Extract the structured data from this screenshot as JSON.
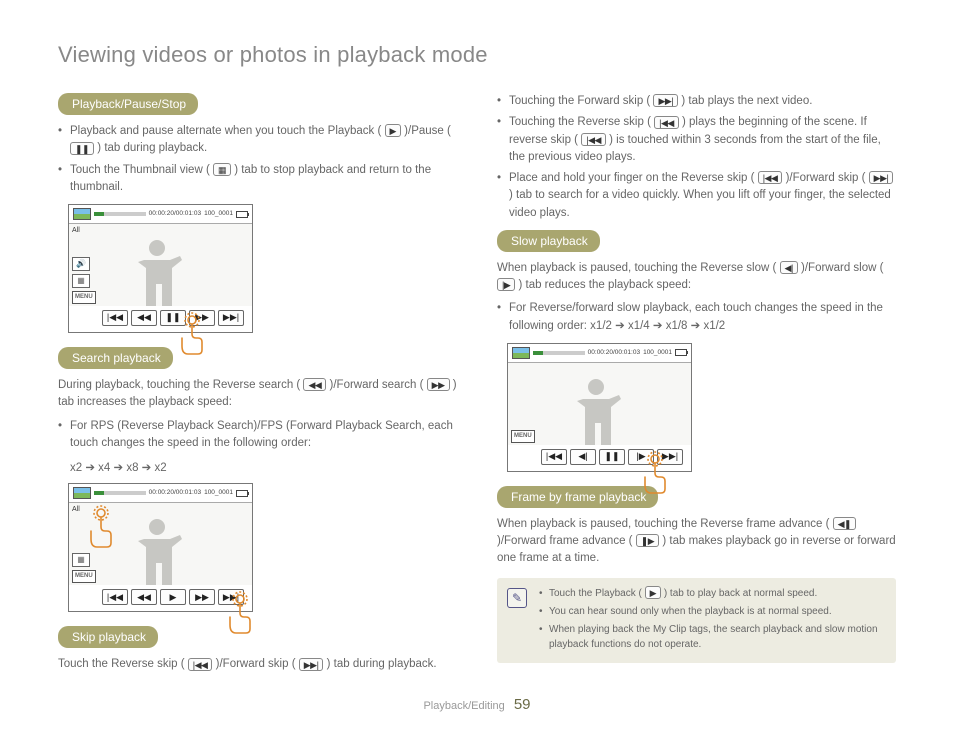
{
  "title": "Viewing videos or photos in playback mode",
  "footer": {
    "section": "Playback/Editing",
    "page": "59"
  },
  "screenshot": {
    "timecode": "00:00:20/00:01:03",
    "clip_id": "100_0001",
    "all_label": "All",
    "menu_label": "MENU"
  },
  "left": {
    "s1": {
      "heading": "Playback/Pause/Stop",
      "b1a": "Playback and pause alternate when you touch the Playback (",
      "b1b": ")/Pause (",
      "b1c": ") tab during playback.",
      "b2a": "Touch the Thumbnail view (",
      "b2b": ") tab to stop playback and return to the thumbnail."
    },
    "s2": {
      "heading": "Search playback",
      "p1a": "During playback, touching the Reverse search (",
      "p1b": ")/Forward search (",
      "p1c": ") tab increases the playback speed:",
      "b1": "For RPS (Reverse Playback Search)/FPS (Forward Playback Search, each touch changes the speed in the following order:",
      "speeds": "x2 ➔ x4 ➔ x8 ➔ x2"
    },
    "s3": {
      "heading": "Skip playback",
      "p1a": "Touch the Reverse skip (",
      "p1b": ")/Forward skip (",
      "p1c": ") tab during playback."
    }
  },
  "right": {
    "skip": {
      "b1a": "Touching the Forward skip (",
      "b1b": ") tab plays the next video.",
      "b2a": "Touching the Reverse skip (",
      "b2b": ") plays the beginning of the scene. If reverse skip (",
      "b2c": ") is touched within 3 seconds from the start of the file, the previous video plays.",
      "b3a": "Place and hold your finger on the Reverse skip (",
      "b3b": ")/Forward skip (",
      "b3c": ") tab to search for a video quickly. When you lift off your finger, the selected video plays."
    },
    "slow": {
      "heading": "Slow playback",
      "p1a": "When playback is paused, touching the Reverse slow (",
      "p1b": ")/Forward slow (",
      "p1c": ") tab reduces the playback speed:",
      "b1": "For Reverse/forward slow playback, each touch changes the speed in the following order: x1/2 ➔ x1/4 ➔ x1/8 ➔ x1/2"
    },
    "frame": {
      "heading": "Frame by frame playback",
      "p1a": "When playback is paused, touching the Reverse frame advance (",
      "p1b": ")/Forward frame advance (",
      "p1c": ") tab makes playback go in reverse or forward one frame at a time."
    },
    "note": {
      "n1a": "Touch the Playback (",
      "n1b": ") tab to play back at normal speed.",
      "n2": "You can hear sound only when the playback is at normal speed.",
      "n3": "When playing back the My Clip tags, the search playback and slow motion playback functions do not operate."
    }
  },
  "icons": {
    "play": "▶",
    "pause": "❚❚",
    "thumb": "▦",
    "rwd": "◀◀",
    "fwd": "▶▶",
    "prev": "|◀◀",
    "next": "▶▶|",
    "slowl": "◀|",
    "slowr": "|▶",
    "framel": "◀❚",
    "framer": "❚▶"
  }
}
